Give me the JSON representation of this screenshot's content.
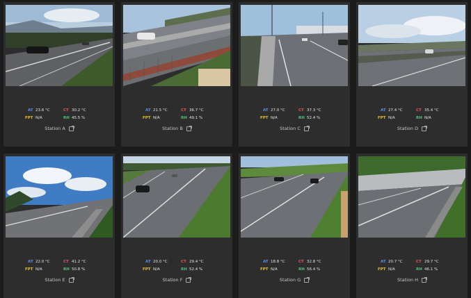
{
  "stations": [
    {
      "name": "Station A",
      "at": "23.6 °C",
      "ct": "30.2 °C",
      "fpt": "N/A",
      "rh": "45.5 %"
    },
    {
      "name": "Station B",
      "at": "21.5 °C",
      "ct": "36.7 °C",
      "fpt": "N/A",
      "rh": "49.1 %"
    },
    {
      "name": "Station C",
      "at": "27.0 °C",
      "ct": "37.3 °C",
      "fpt": "N/A",
      "rh": "52.4 %"
    },
    {
      "name": "Station D",
      "at": "27.4 °C",
      "ct": "35.4 °C",
      "fpt": "N/A",
      "rh": "N/A"
    },
    {
      "name": "Station E",
      "at": "22.0 °C",
      "ct": "41.2 °C",
      "fpt": "N/A",
      "rh": "50.8 %"
    },
    {
      "name": "Station F",
      "at": "20.0 °C",
      "ct": "29.4 °C",
      "fpt": "N/A",
      "rh": "52.4 %"
    },
    {
      "name": "Station G",
      "at": "18.8 °C",
      "ct": "32.8 °C",
      "fpt": "N/A",
      "rh": "56.4 %"
    },
    {
      "name": "Station H",
      "at": "20.7 °C",
      "ct": "29.7 °C",
      "fpt": "N/A",
      "rh": "46.1 %"
    }
  ],
  "labels": {
    "at": "AT",
    "ct": "CT",
    "fpt": "FPT",
    "rh": "RH"
  },
  "icons": {
    "station_link": "external-link-icon",
    "camera": "camera-image"
  },
  "colors": {
    "at": "#5a8fe6",
    "ct": "#e05858",
    "fpt": "#e3c12a",
    "rh": "#52c27a",
    "card_bg": "#2d2d2d",
    "page_bg": "#1c1c1c"
  }
}
